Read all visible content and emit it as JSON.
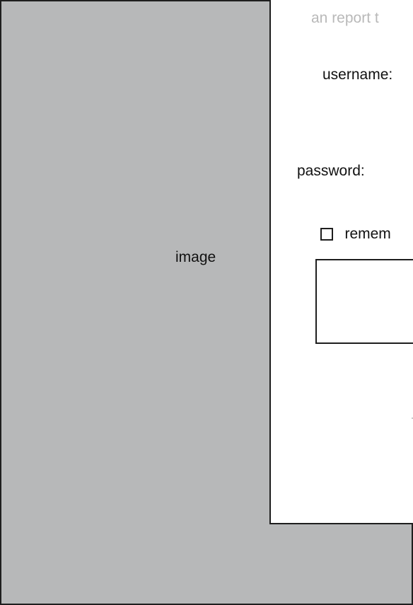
{
  "image_placeholder": {
    "label": "image",
    "background": "#b7b8b9",
    "border": "#1e1e1e"
  },
  "login_panel": {
    "report_text": "an report t",
    "username_label": "username:",
    "password_label": "password:",
    "remember_label": "remem",
    "remember_checked": false,
    "button_label": ""
  },
  "colors": {
    "panel_background": "#ffffff",
    "muted_text": "#b9b9b9",
    "text": "#111111"
  }
}
